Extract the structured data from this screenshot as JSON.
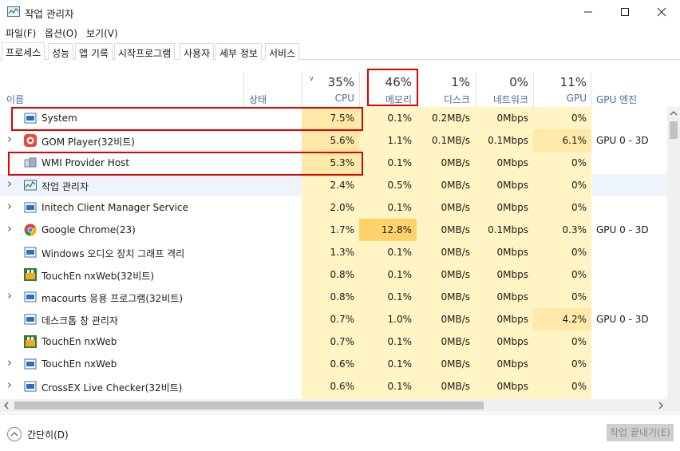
{
  "window": {
    "title": "작업 관리자"
  },
  "controls": {
    "minimize": "–",
    "maximize": "☐",
    "close": "✕"
  },
  "menu": [
    "파일(F)",
    "옵션(O)",
    "보기(V)"
  ],
  "tabs": [
    "프로세스",
    "성능",
    "앱 기록",
    "시작프로그램",
    "사용자",
    "세부 정보",
    "서비스"
  ],
  "columns": {
    "name": "이름",
    "status": "상태",
    "cpu": {
      "pct": "35%",
      "label": "CPU"
    },
    "memory": {
      "pct": "46%",
      "label": "메모리"
    },
    "disk": {
      "pct": "1%",
      "label": "디스크"
    },
    "network": {
      "pct": "0%",
      "label": "네트워크"
    },
    "gpu": {
      "pct": "11%",
      "label": "GPU"
    },
    "gpu_engine": "GPU 엔진"
  },
  "rows": [
    {
      "name": "System",
      "cpu": "7.5%",
      "mem": "0.1%",
      "disk": "0.2MB/s",
      "net": "0Mbps",
      "gpu": "0%",
      "engine": "",
      "expand": false,
      "icon": "system-icon"
    },
    {
      "name": "GOM Player(32비트)",
      "cpu": "5.6%",
      "mem": "1.1%",
      "disk": "0.1MB/s",
      "net": "0.1Mbps",
      "gpu": "6.1%",
      "engine": "GPU 0 - 3D",
      "expand": true,
      "icon": "gom-player-icon"
    },
    {
      "name": "WMI Provider Host",
      "cpu": "5.3%",
      "mem": "0.1%",
      "disk": "0MB/s",
      "net": "0Mbps",
      "gpu": "0%",
      "engine": "",
      "expand": false,
      "icon": "wmi-icon"
    },
    {
      "name": "작업 관리자",
      "cpu": "2.4%",
      "mem": "0.5%",
      "disk": "0MB/s",
      "net": "0Mbps",
      "gpu": "0%",
      "engine": "",
      "expand": true,
      "icon": "task-manager-icon"
    },
    {
      "name": "Initech Client Manager Service",
      "cpu": "2.0%",
      "mem": "0.1%",
      "disk": "0MB/s",
      "net": "0Mbps",
      "gpu": "0%",
      "engine": "",
      "expand": true,
      "icon": "service-icon"
    },
    {
      "name": "Google Chrome(23)",
      "cpu": "1.7%",
      "mem": "12.8%",
      "disk": "0MB/s",
      "net": "0.1Mbps",
      "gpu": "0.3%",
      "engine": "GPU 0 - 3D",
      "expand": true,
      "icon": "chrome-icon"
    },
    {
      "name": "Windows 오디오 장치 그래프 격리",
      "cpu": "1.3%",
      "mem": "0.1%",
      "disk": "0MB/s",
      "net": "0Mbps",
      "gpu": "0%",
      "engine": "",
      "expand": false,
      "icon": "service-icon"
    },
    {
      "name": "TouchEn nxWeb(32비트)",
      "cpu": "0.8%",
      "mem": "0.1%",
      "disk": "0MB/s",
      "net": "0Mbps",
      "gpu": "0%",
      "engine": "",
      "expand": false,
      "icon": "touchen-icon"
    },
    {
      "name": "macourts 응용 프로그램(32비트)",
      "cpu": "0.8%",
      "mem": "0.1%",
      "disk": "0MB/s",
      "net": "0Mbps",
      "gpu": "0%",
      "engine": "",
      "expand": true,
      "icon": "service-icon"
    },
    {
      "name": "데스크톱 창 관리자",
      "cpu": "0.7%",
      "mem": "1.0%",
      "disk": "0MB/s",
      "net": "0Mbps",
      "gpu": "4.2%",
      "engine": "GPU 0 - 3D",
      "expand": false,
      "icon": "service-icon"
    },
    {
      "name": "TouchEn nxWeb",
      "cpu": "0.7%",
      "mem": "0.1%",
      "disk": "0MB/s",
      "net": "0Mbps",
      "gpu": "0%",
      "engine": "",
      "expand": false,
      "icon": "touchen-icon"
    },
    {
      "name": "TouchEn nxWeb",
      "cpu": "0.6%",
      "mem": "0.1%",
      "disk": "0MB/s",
      "net": "0Mbps",
      "gpu": "0%",
      "engine": "",
      "expand": true,
      "icon": "service-icon"
    },
    {
      "name": "CrossEX Live Checker(32비트)",
      "cpu": "0.6%",
      "mem": "0.1%",
      "disk": "0MB/s",
      "net": "0Mbps",
      "gpu": "0%",
      "engine": "",
      "expand": true,
      "icon": "service-icon"
    }
  ],
  "footer": {
    "fewer_details": "간단히(D)",
    "end_task": "작업 끝내기(E)"
  },
  "colors": {
    "cell_light": "#fff4c4",
    "cell_mid": "#ffe8a8",
    "cell_strong": "#ffd26b",
    "selected_row": "#eef4fb",
    "highlight_box": "#e00000",
    "header_text": "#4a6aa0"
  }
}
